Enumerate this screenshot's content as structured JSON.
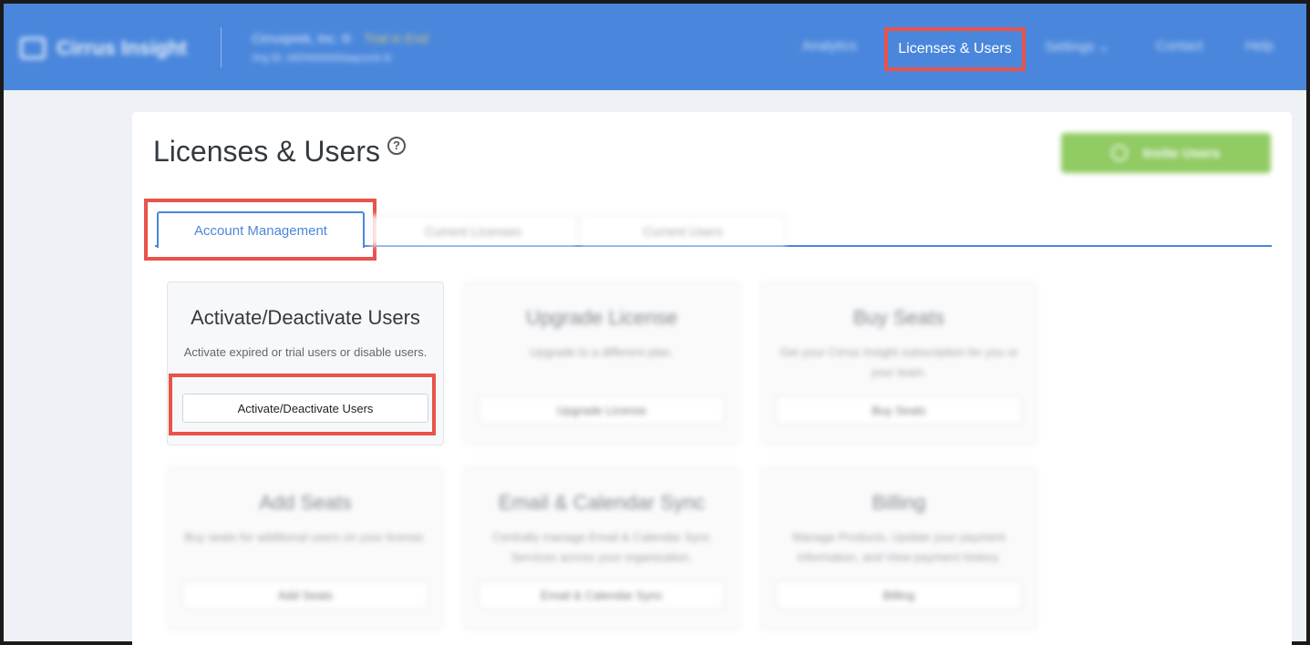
{
  "header": {
    "logo_text": "Cirrus Insight",
    "company_name": "Cirrusprek, Inc. ®",
    "trial_link": "Trial in End",
    "company_sub": "Org ID: 00D5000000aayzzcb ⧉",
    "nav": [
      "Analytics",
      "Licenses & Users",
      "Settings ⌄",
      "Contact",
      "Help"
    ]
  },
  "page": {
    "title": "Licenses & Users",
    "help_symbol": "?",
    "invite_label": "Invite Users"
  },
  "tabs": [
    {
      "label": "Account Management"
    },
    {
      "label": "Current Licenses"
    },
    {
      "label": "Current Users"
    }
  ],
  "cards": [
    {
      "title": "Activate/Deactivate Users",
      "desc": "Activate expired or trial users or disable users.",
      "button": "Activate/Deactivate Users"
    },
    {
      "title": "Upgrade License",
      "desc": "Upgrade to a different plan.",
      "button": "Upgrade License"
    },
    {
      "title": "Buy Seats",
      "desc": "Get your Cirrus Insight subscription for you or your team.",
      "button": "Buy Seats"
    },
    {
      "title": "Add Seats",
      "desc": "Buy seats for additional users on your license.",
      "button": "Add Seats"
    },
    {
      "title": "Email & Calendar Sync",
      "desc": "Centrally manage Email & Calendar Sync Services across your organization.",
      "button": "Email & Calendar Sync"
    },
    {
      "title": "Billing",
      "desc": "Manage Products, Update your payment information, and View payment history.",
      "button": "Billing"
    }
  ],
  "colors": {
    "header": "#4a87dc",
    "highlight": "#e8534a",
    "invite": "#7dc248"
  }
}
